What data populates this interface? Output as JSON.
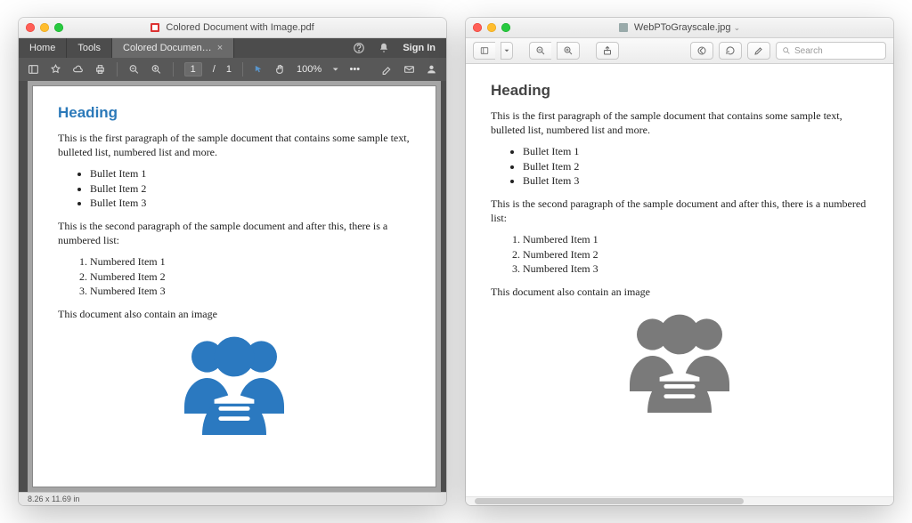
{
  "acrobat": {
    "window_title": "Colored Document with Image.pdf",
    "tabs": {
      "home": "Home",
      "tools": "Tools",
      "doc_label": "Colored Documen…",
      "doc_close": "×"
    },
    "topright": {
      "signin": "Sign In"
    },
    "toolbar": {
      "page_current": "1",
      "page_sep": "/",
      "page_total": "1",
      "zoom": "100%",
      "more": "•••"
    },
    "status": "8.26 x 11.69 in",
    "doc": {
      "heading": "Heading",
      "p1": "This is the first paragraph of the sample document that contains some sample text, bulleted list, numbered list and more.",
      "bullets": [
        "Bullet Item 1",
        "Bullet Item 2",
        "Bullet Item 3"
      ],
      "p2": "This is the second paragraph of the sample document and after this, there is a numbered list:",
      "numbered": [
        "Numbered Item 1",
        "Numbered Item 2",
        "Numbered Item 3"
      ],
      "p3": "This document also contain an image",
      "image_color": "#2b79c0"
    }
  },
  "preview": {
    "window_title": "WebPToGrayscale.jpg",
    "title_chevron": "⌄",
    "search_placeholder": "Search",
    "doc": {
      "heading": "Heading",
      "p1": "This is the first paragraph of the sample document that contains some sample text, bulleted list, numbered list and more.",
      "bullets": [
        "Bullet Item 1",
        "Bullet Item 2",
        "Bullet Item 3"
      ],
      "p2": "This is the second paragraph of the sample document and after this, there is a numbered list:",
      "numbered": [
        "Numbered Item 1",
        "Numbered Item 2",
        "Numbered Item 3"
      ],
      "p3": "This document also contain an image",
      "image_color": "#7a7a7a"
    }
  }
}
